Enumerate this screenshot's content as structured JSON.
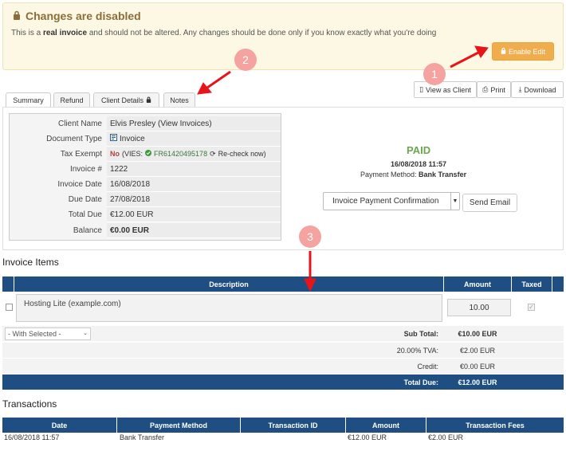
{
  "banner": {
    "title": "Changes are disabled",
    "text_before": "This is a ",
    "text_bold": "real invoice",
    "text_after": " and should not be altered. Any changes should be done only if you know exactly what you're doing",
    "enable_edit": "Enable Edit"
  },
  "actions": {
    "view_as_client": "View as Client",
    "print": "Print",
    "download": "Download"
  },
  "tabs": [
    "Summary",
    "Refund",
    "Client Details",
    "Notes"
  ],
  "summary": {
    "rows": [
      {
        "label": "Client Name",
        "value": "Elvis Presley (View Invoices)"
      },
      {
        "label": "Document Type",
        "value": "Invoice"
      },
      {
        "label": "Tax Exempt",
        "value_no": "No",
        "value_vies": "(VIES:",
        "value_vat": "FR61420495178",
        "value_recheck": "Re-check now)"
      },
      {
        "label": "Invoice #",
        "value": "1222"
      },
      {
        "label": "Invoice Date",
        "value": "16/08/2018"
      },
      {
        "label": "Due Date",
        "value": "27/08/2018"
      },
      {
        "label": "Total Due",
        "value": "€12.00 EUR"
      },
      {
        "label": "Balance",
        "value": "€0.00 EUR"
      }
    ]
  },
  "status": {
    "paid": "PAID",
    "date": "16/08/2018 11:57",
    "method_label": "Payment Method: ",
    "method_value": "Bank Transfer",
    "email_select": "Invoice Payment Confirmation",
    "send_email": "Send Email"
  },
  "invoice_items": {
    "heading": "Invoice Items",
    "headers": {
      "description": "Description",
      "amount": "Amount",
      "taxed": "Taxed"
    },
    "item": {
      "description": "Hosting Lite (example.com)",
      "amount": "10.00"
    },
    "with_selected": "- With Selected -",
    "totals": [
      {
        "label": "Sub Total:",
        "value": "€10.00 EUR"
      },
      {
        "label": "20.00% TVA:",
        "value": "€2.00 EUR"
      },
      {
        "label": "Credit:",
        "value": "€0.00 EUR"
      },
      {
        "label": "Total Due:",
        "value": "€12.00 EUR"
      }
    ]
  },
  "transactions": {
    "heading": "Transactions",
    "headers": [
      "Date",
      "Payment Method",
      "Transaction ID",
      "Amount",
      "Transaction Fees"
    ],
    "row": [
      "16/08/2018 11:57",
      "Bank Transfer",
      "",
      "€12.00 EUR",
      "€2.00 EUR"
    ]
  },
  "annotations": [
    "1",
    "2",
    "3"
  ],
  "colors": {
    "header_blue": "#1f4f82",
    "accent_orange": "#f0ad4e",
    "arrow_red": "#e8141b",
    "badge": "#f4a3a0"
  }
}
